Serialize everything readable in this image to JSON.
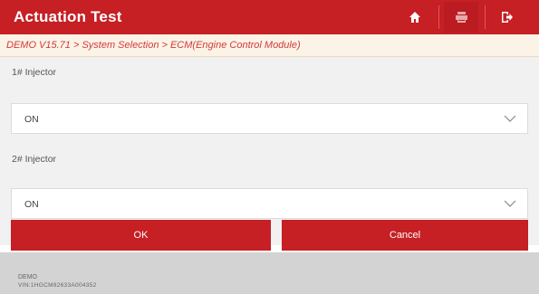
{
  "header": {
    "title": "Actuation Test",
    "buttons": {
      "home_icon": "home-icon",
      "print_icon": "print-icon",
      "exit_icon": "exit-icon"
    },
    "accent_color": "#c61f24"
  },
  "breadcrumb": "DEMO V15.71 > System Selection > ECM(Engine Control Module)",
  "fields": [
    {
      "label": "1# Injector",
      "value": "ON"
    },
    {
      "label": "2# Injector",
      "value": "ON"
    }
  ],
  "actions": {
    "ok_label": "OK",
    "cancel_label": "Cancel"
  },
  "footer": {
    "line1": "DEMO",
    "line2": "VIN:1HGCM82633A004352"
  }
}
